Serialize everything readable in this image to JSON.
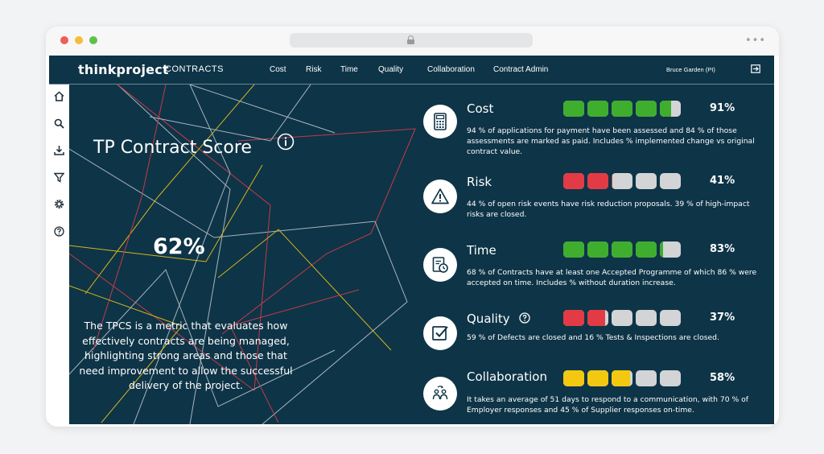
{
  "colors": {
    "app_bg": "#0e3447",
    "green": "#3fae2f",
    "red": "#e23b45",
    "yellow": "#f3c811",
    "empty": "#d3d4d6"
  },
  "header": {
    "logo": "thinkproject",
    "logo_sub": "CONTRACTS",
    "nav": [
      "Cost",
      "Risk",
      "Time",
      "Quality",
      "Collaboration",
      "Contract Admin"
    ],
    "user": "Bruce Garden (PI)",
    "logout_icon": "logout-icon"
  },
  "sidebar": {
    "icons": [
      "home-icon",
      "search-icon",
      "download-icon",
      "filter-icon",
      "gear-icon",
      "help-icon"
    ]
  },
  "hero": {
    "title": "TP Contract Score",
    "score": "62%",
    "description": "The TPCS is a metric that evaluates how effectively contracts are being managed, highlighting strong areas and those that need improvement to allow the successful delivery of the project."
  },
  "metrics": [
    {
      "name": "Cost",
      "percent": "91%",
      "value": 0.91,
      "color": "green",
      "icon": "calculator-icon",
      "description": "94 % of applications for payment have been assessed and 84 % of those assessments are marked as paid. Includes % implemented change vs original contract value."
    },
    {
      "name": "Risk",
      "percent": "41%",
      "value": 0.41,
      "color": "red",
      "icon": "warning-icon",
      "description": "44 % of open risk events have risk reduction proposals. 39 % of high-impact risks are closed."
    },
    {
      "name": "Time",
      "percent": "83%",
      "value": 0.83,
      "color": "green",
      "icon": "schedule-icon",
      "description": "68 % of Contracts have at least one Accepted Programme of which 86 % were accepted on time. Includes % without duration increase."
    },
    {
      "name": "Quality",
      "percent": "37%",
      "value": 0.37,
      "color": "red",
      "icon": "checkbox-icon",
      "description": "59 % of Defects are closed and 16 % Tests & Inspections are closed."
    },
    {
      "name": "Collaboration",
      "percent": "58%",
      "value": 0.58,
      "color": "yellow",
      "icon": "people-icon",
      "description": "It takes an average of 51 days to respond to a communication, with 70 % of Employer responses and 45 % of Supplier responses on-time."
    }
  ]
}
